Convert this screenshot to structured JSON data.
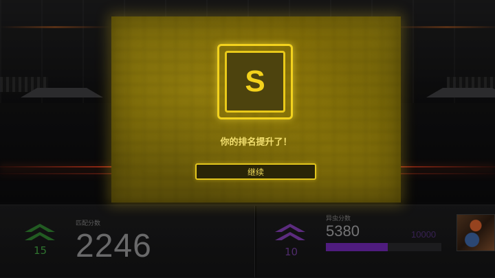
{
  "modal": {
    "rank_letter": "S",
    "message": "你的排名提升了！",
    "continue_label": "继续"
  },
  "matchmaking": {
    "label": "匹配分数",
    "rank_level": "15",
    "score": "2246",
    "chevron_color": "#2e7a2e"
  },
  "alien": {
    "label": "异虫分数",
    "rank_level": "10",
    "score": "5380",
    "max": "10000",
    "progress": 0.538,
    "chevron_color": "#7a3aa8"
  },
  "colors": {
    "accent_yellow": "#f2d21e",
    "modal_bg": "#6d5e08",
    "progress_purple": "#6a26a8"
  },
  "icons": {
    "rank_up_chevrons": "double-chevron-up-icon",
    "portrait": "zerg-portrait-icon"
  }
}
